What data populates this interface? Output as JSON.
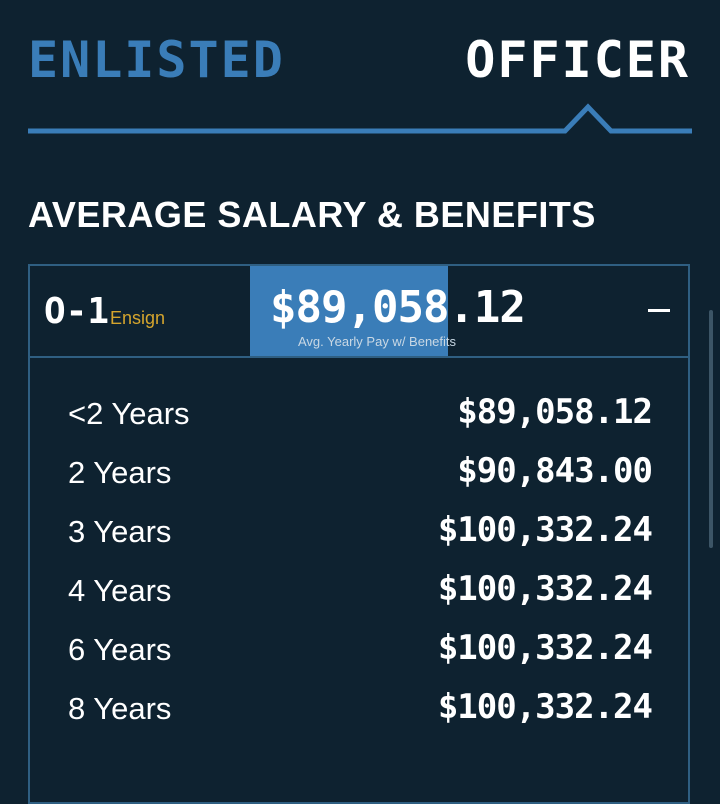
{
  "tabs": {
    "enlisted": "ENLISTED",
    "officer": "OFFICER",
    "active": "officer"
  },
  "section_title": "AVERAGE SALARY & BENEFITS",
  "rank": {
    "code": "O-1",
    "title": "Ensign",
    "avg_pay": "$89,058.12",
    "avg_pay_caption": "Avg. Yearly Pay w/ Benefits",
    "expanded": true,
    "collapse_icon": "minus-icon"
  },
  "pay_rows": [
    {
      "years": "<2 Years",
      "amount": "$89,058.12"
    },
    {
      "years": "2 Years",
      "amount": "$90,843.00"
    },
    {
      "years": "3 Years",
      "amount": "$100,332.24"
    },
    {
      "years": "4 Years",
      "amount": "$100,332.24"
    },
    {
      "years": "6 Years",
      "amount": "$100,332.24"
    },
    {
      "years": "8 Years",
      "amount": "$100,332.24"
    }
  ],
  "colors": {
    "background": "#0e2230",
    "accent_blue": "#3a7db8",
    "border": "#2f5f82",
    "rank_title": "#d5a52d"
  }
}
